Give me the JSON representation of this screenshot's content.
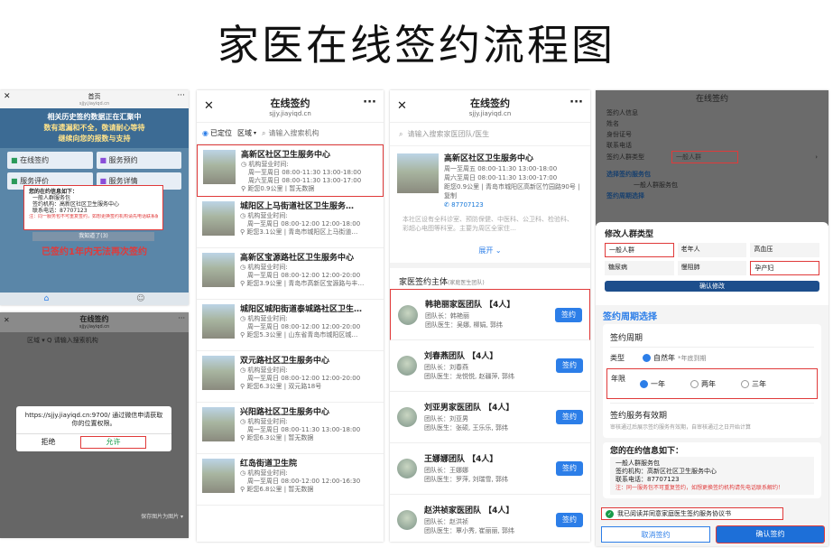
{
  "page_title": "家医在线签约流程图",
  "s1": {
    "title": "首页",
    "url": "sjjy.jiayiqd.cn",
    "banner_line1": "相关历史签约数据正在汇聚中",
    "banner_line2": "数有遗漏和不全，敬请耐心等待",
    "banner_line3": "继续向您的报数与支持",
    "tiles": [
      "在线签约",
      "服务预约",
      "服务评价",
      "服务详情"
    ],
    "popup_title": "您的在约信息如下：",
    "popup_l1": "一般人群服务包",
    "popup_l2": "签约机构：高新区社区卫生服务中心",
    "popup_l3": "联系电话：87707123",
    "popup_warn": "注：同一服务包不可重复签约，如想更换签约机构请先电话联系解约！",
    "popup_btn": "我知道了(3)",
    "red_note": "已签约1年内无法再次签约"
  },
  "s2": {
    "title": "在线签约",
    "url": "sjjy.jiayiqd.cn",
    "toolbar": "区域 ▾  Q 请输入搜索机构",
    "dialog_msg": "https://sjjy.jiayiqd.cn:9700/ 通过微信申请获取你的位置权限。",
    "reject": "拒绝",
    "allow": "允许",
    "save": "保存图片为图片 ▾"
  },
  "s3": {
    "title": "在线签约",
    "url": "sjjy.jiayiqd.cn",
    "located": "已定位",
    "region": "区域",
    "search_placeholder": "请输入搜索机构",
    "items": [
      {
        "name": "高新区社区卫生服务中心",
        "l1": "机构营业时间:",
        "l2": "周一至周日 08:00-11:30 13:00-18:00",
        "l3": "周六至周日 08:00-11:30 13:00-17:00",
        "l4": "距您0.9公里 | 暂无数据"
      },
      {
        "name": "城阳区上马街道社区卫生服务…",
        "l1": "机构营业时间:",
        "l2": "周一至周日 08:00-12:00 12:00-18:00",
        "l3": "",
        "l4": "距您3.1公里 | 青岛市城阳区上马街道…"
      },
      {
        "name": "高新区宝源路社区卫生服务中心",
        "l1": "机构营业时间:",
        "l2": "周一至周日 08:00-12:00 12:00-20:00",
        "l3": "",
        "l4": "距您3.9公里 | 青岛市高新区宝源路与丰…"
      },
      {
        "name": "城阳区城阳街道泰城路社区卫生…",
        "l1": "机构营业时间:",
        "l2": "周一至周日 08:00-12:00 12:00-20:00",
        "l3": "",
        "l4": "距您5.3公里 | 山东省青岛市城阳区城…"
      },
      {
        "name": "双元路社区卫生服务中心",
        "l1": "机构营业时间:",
        "l2": "周一至周日 08:00-12:00 12:00-20:00",
        "l3": "",
        "l4": "距您6.3公里 | 双元路18号"
      },
      {
        "name": "兴阳路社区卫生服务中心",
        "l1": "机构营业时间:",
        "l2": "周一至周日 08:00-11:30 13:00-18:00",
        "l3": "",
        "l4": "距您6.3公里 | 暂无数据"
      },
      {
        "name": "红岛街道卫生院",
        "l1": "机构营业时间:",
        "l2": "周一至周日 08:00-12:00 12:00-16:30",
        "l3": "",
        "l4": "距您6.8公里 | 暂无数据"
      }
    ]
  },
  "s4": {
    "title": "在线签约",
    "url": "sjjy.jiayiqd.cn",
    "search_placeholder": "请输入搜索家医团队/医生",
    "org_name": "高新区社区卫生服务中心",
    "org_l1": "周一至周五 08:00-11:30 13:00-18:00",
    "org_l2": "周六至周日 08:00-11:30 13:00-17:00",
    "org_l3": "距您0.9公里 | 青岛市城阳区高新区竹园路90号 | 复制",
    "org_phone": "87707123",
    "desc": "本社区设有全科诊室、预防保健、中医科、公卫科、检验科、彩超心电图等科室。主要为周区全家住…",
    "expand": "展开",
    "section": "家医签约主体",
    "section_sub": "(家庭医生团队)",
    "teams": [
      {
        "name": "韩艳丽家医团队 【4人】",
        "leader": "团队长：韩艳丽",
        "docs": "团队医生：吴娜, 柳娟, 郭纬"
      },
      {
        "name": "刘春燕团队 【4人】",
        "leader": "团队长：刘春燕",
        "docs": "团队医生：龙悦悦, 赵疆萍, 郭纬"
      },
      {
        "name": "刘亚男家医团队 【4人】",
        "leader": "团队长：刘亚男",
        "docs": "团队医生：张硕, 王乐乐, 郭纬"
      },
      {
        "name": "王娜娜团队 【4人】",
        "leader": "团队长：王娜娜",
        "docs": "团队医生：罗萍, 刘瑞雪, 郭纬"
      },
      {
        "name": "赵洪祯家医团队 【4人】",
        "leader": "团队长：赵洪祯",
        "docs": "团队医生：覃小秀, 崔丽丽, 郭纬"
      }
    ],
    "sign": "签约"
  },
  "s5": {
    "title": "在线签约",
    "url": "sjjy.jiayiqd.cn",
    "f1": "签约人信息",
    "f2": "姓名",
    "f3": "身份证号",
    "f4": "联系电话",
    "f5": "签约人群类型",
    "f5v": "一般人群",
    "pkg": "选择签约服务包",
    "pkg_item": "一般人群服务包",
    "pkg_sub": "签约周期选择",
    "modal_title": "修改人群类型",
    "types": [
      "一般人群",
      "老年人",
      "高血压",
      "糖尿病",
      "慢阻肺",
      "孕产妇"
    ],
    "confirm_edit": "确认修改",
    "cycle_head": "签约周期选择",
    "cycle_label": "签约周期",
    "type_label": "类型",
    "type_val": "自然年",
    "type_note": "*年底到期",
    "year_label": "年限",
    "years": [
      "一年",
      "两年",
      "三年"
    ],
    "valid_label": "签约服务有效期",
    "valid_note": "审核通过后展示签约服务有效期，自审核通过之日开始计算",
    "info_title": "您的在约信息如下：",
    "info_l1": "一般人群服务包",
    "info_l2": "签约机构：高新区社区卫生服务中心",
    "info_l3": "联系电话：87707123",
    "info_warn": "注：同一服务包不可重复签约，如想更换签约机构请先电话联系解约！",
    "agree": "我已阅读并同意家庭医生签约服务协议书",
    "cancel": "取消签约",
    "confirm": "确认签约"
  }
}
